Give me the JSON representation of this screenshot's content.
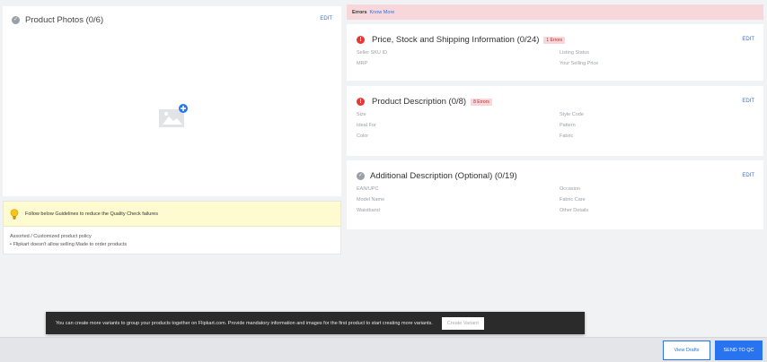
{
  "photos": {
    "title": "Product Photos (0/6)",
    "edit_label": "EDIT",
    "placeholder_icon": "image-add-icon"
  },
  "guidelines": {
    "banner_text": "Follow below Guidelines to reduce the Quality Check failures",
    "policy_title": "Assorted / Customized product policy",
    "policy_item": "•  Flipkart doesn't allow selling Made to order products"
  },
  "errors_bar": {
    "label": "Errors",
    "link": "Know More"
  },
  "sections": {
    "price": {
      "title": "Price, Stock and Shipping Information (0/24)",
      "badge": "1 Errors",
      "edit_label": "EDIT",
      "fields": [
        "Seller SKU ID",
        "Listing Status",
        "MRP",
        "Your Selling Price"
      ]
    },
    "description": {
      "title": "Product Description (0/8)",
      "badge": "8 Errors",
      "edit_label": "EDIT",
      "fields": [
        "Size",
        "Style Code",
        "Ideal For",
        "Pattern",
        "Color",
        "Fabric"
      ]
    },
    "additional": {
      "title": "Additional Description (Optional) (0/19)",
      "edit_label": "EDIT",
      "fields": [
        "EAN/UPC",
        "Occasion",
        "Model Name",
        "Fabric Care",
        "Waistband",
        "Other Details"
      ]
    }
  },
  "toast": {
    "text": "You can create more variants to group your products together on Flipkart.com. Provide mandatory information and images for the first product to start creating more variants.",
    "button": "Create Variant"
  },
  "footer": {
    "view_drafts": "View Drafts",
    "send_to_qc": "SEND TO QC"
  },
  "colors": {
    "accent": "#2874f0",
    "error": "#e53935",
    "error_bg": "#f7d7d9",
    "guide_bg": "#fffbd0"
  }
}
